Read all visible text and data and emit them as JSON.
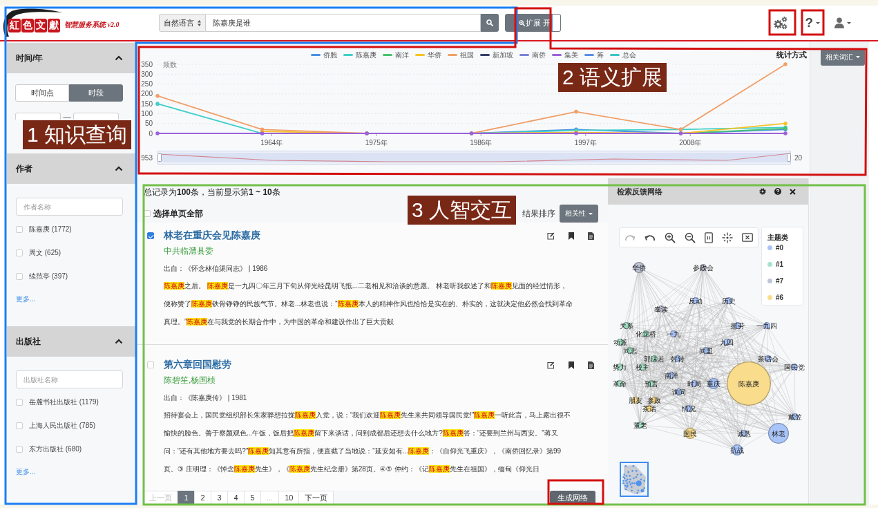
{
  "header": {
    "logo": {
      "tiles": [
        "紅",
        "色",
        "文",
        "獻"
      ],
      "subtitle": "智慧服务系统 v2.0"
    },
    "search": {
      "mode": "自然语言",
      "value": "陈嘉庚是谁"
    },
    "expand_toggle": {
      "label": "扩展",
      "state_label": "开",
      "on": true
    },
    "help_menu": {
      "label": "?"
    }
  },
  "sidebar": {
    "sections": [
      {
        "kind": "time",
        "title": "时间/年",
        "expanded": true,
        "modes": [
          {
            "label": "时间点",
            "selected": false
          },
          {
            "label": "时段",
            "selected": true
          }
        ],
        "separator": "—"
      },
      {
        "kind": "facet",
        "title": "作者",
        "expanded": true,
        "placeholder": "作者名称",
        "items": [
          {
            "label": "陈嘉庚 (1772)",
            "checked": false
          },
          {
            "label": "周文 (625)",
            "checked": false
          },
          {
            "label": "续范亭 (397)",
            "checked": false
          }
        ],
        "more": "更多..."
      },
      {
        "kind": "facet",
        "title": "出版社",
        "expanded": true,
        "placeholder": "出版社名称",
        "items": [
          {
            "label": "岳麓书社出版社 (1179)",
            "checked": false
          },
          {
            "label": "上海人民出版社 (785)",
            "checked": false
          },
          {
            "label": "东方出版社 (680)",
            "checked": false
          }
        ],
        "more": "更多..."
      }
    ]
  },
  "chart_panel": {
    "stat_label": "统计方式",
    "stat_button": "相关词汇",
    "chart_data": {
      "type": "line",
      "ylabel": "频数",
      "grid": true,
      "x": [
        1952,
        1963,
        1974,
        1985,
        1996,
        2007,
        2018
      ],
      "xlim": [
        1952,
        2018
      ],
      "ylim": [
        0,
        350
      ],
      "xticks": [
        {
          "value": 1964,
          "label": "1964年"
        },
        {
          "value": 1975,
          "label": "1975年"
        },
        {
          "value": 1986,
          "label": "1986年"
        },
        {
          "value": 1997,
          "label": "1997年"
        },
        {
          "value": 2008,
          "label": "2008年"
        }
      ],
      "yticks": [
        0,
        50,
        100,
        150,
        200,
        250,
        300,
        350
      ],
      "series": [
        {
          "name": "侨胞",
          "color": "#4a90e2",
          "values": [
            null,
            null,
            null,
            0,
            20,
            0,
            20
          ]
        },
        {
          "name": "陈嘉庚",
          "color": "#3fd0c9",
          "values": [
            150,
            0,
            0,
            0,
            15,
            20,
            30
          ]
        },
        {
          "name": "南洋",
          "color": "#47c36f",
          "values": [
            null,
            null,
            null,
            null,
            null,
            0,
            25
          ]
        },
        {
          "name": "华侨",
          "color": "#f7c325",
          "values": [
            null,
            10,
            0,
            0,
            5,
            0,
            50
          ]
        },
        {
          "name": "祖国",
          "color": "#f0a068",
          "values": [
            190,
            20,
            0,
            0,
            110,
            20,
            350
          ]
        },
        {
          "name": "新加坡",
          "color": "#34406b",
          "values": [
            null,
            null,
            null,
            null,
            null,
            null,
            null
          ]
        },
        {
          "name": "南侨",
          "color": "#7b82d6",
          "values": [
            null,
            null,
            null,
            null,
            null,
            null,
            null
          ]
        },
        {
          "name": "集美",
          "color": "#9a62db",
          "values": [
            0,
            0,
            0,
            0,
            0,
            0,
            0
          ]
        },
        {
          "name": "筹",
          "color": "#5b8ee6",
          "values": [
            null,
            null,
            null,
            null,
            null,
            null,
            null
          ]
        },
        {
          "name": "总会",
          "color": "#3cc5c5",
          "values": [
            null,
            null,
            null,
            null,
            null,
            null,
            null
          ]
        }
      ]
    },
    "zoom_slider": {
      "start_label": "953",
      "end_label": "20",
      "level": 1
    }
  },
  "results": {
    "summary": "总记录为**100**条，当前显示第**1 ~ 10**条",
    "select_all": {
      "label": "选择单页全部",
      "checked": false
    },
    "sort_label": "结果排序",
    "sort_button": "相关性",
    "items": [
      {
        "checked": true,
        "title": "林老在重庆会见陈嘉庚",
        "author": "中共临澧县委",
        "source": "出自：《怀念林伯渠同志》 | 1986",
        "snippet": [
          {
            "text": "陈嘉庚",
            "highlight": true
          },
          {
            "text": "之后。 ",
            "highlight": false
          },
          {
            "text": "陈嘉庚",
            "highlight": true
          },
          {
            "text": "是一九四〇年三月下旬从仰光经昆明飞抵...二老相见和洽谈的意愿。 林老听我叙述了和",
            "highlight": false
          },
          {
            "text": "陈嘉庚",
            "highlight": true
          },
          {
            "text": "见面的经过情形，便称赞了",
            "highlight": false
          },
          {
            "text": "陈嘉庚",
            "highlight": true
          },
          {
            "text": "铁骨铮铮的民族气节。林老...林老也说：“",
            "highlight": false
          },
          {
            "text": "陈嘉庚",
            "highlight": true
          },
          {
            "text": "本人的精神作风也恰恰是实在的、朴实的，这就决定他必然会找到革命真理。”",
            "highlight": false
          },
          {
            "text": "陈嘉庚",
            "highlight": true
          },
          {
            "text": "在与我党的长期合作中，为中国的革命和建设作出了巨大贡献",
            "highlight": false
          }
        ]
      },
      {
        "checked": false,
        "title": "第六章回国慰劳",
        "author": "陈碧笙,杨国桢",
        "source": "出自：《陈嘉庚传》 | 1981",
        "snippet": [
          {
            "text": "招待宴会上，国民党组织部长朱家骅想拉拢",
            "highlight": false
          },
          {
            "text": "陈嘉庚",
            "highlight": true
          },
          {
            "text": "入党，说：“我们欢迎",
            "highlight": false
          },
          {
            "text": "陈嘉庚",
            "highlight": true
          },
          {
            "text": "先生来共同领导国民党!”",
            "highlight": false
          },
          {
            "text": "陈嘉庚",
            "highlight": true
          },
          {
            "text": "一听此言，马上露出很不愉快的脸色。善于察颜观色...午饭，饭后把",
            "highlight": false
          },
          {
            "text": "陈嘉庚",
            "highlight": true
          },
          {
            "text": "留下来谈话，问到成都后还想去什么地方?",
            "highlight": false
          },
          {
            "text": "陈嘉庚",
            "highlight": true
          },
          {
            "text": "答：“还要到兰州与西安。”蒋又问：“还有其他地方要去吗?”",
            "highlight": false
          },
          {
            "text": "陈嘉庚",
            "highlight": true
          },
          {
            "text": "知其意有所指，便直截了当地说：“延安如有...",
            "highlight": false
          },
          {
            "text": "陈嘉庚",
            "highlight": true
          },
          {
            "text": "：《自仰光飞重庆》，《南侨回忆录》第99页。③ 庄明理：《悼念",
            "highlight": false
          },
          {
            "text": "陈嘉庚",
            "highlight": true
          },
          {
            "text": "先生》，《",
            "highlight": false
          },
          {
            "text": "陈嘉庚",
            "highlight": true
          },
          {
            "text": "先生纪念册》第28页。④⑤ 仲约：《记",
            "highlight": false
          },
          {
            "text": "陈嘉庚",
            "highlight": true
          },
          {
            "text": "先生在祖国》，缅甸《仰光日",
            "highlight": false
          }
        ]
      }
    ],
    "pagination": [
      {
        "label": "上一页",
        "selected": false,
        "disabled": true
      },
      {
        "label": "1",
        "selected": true,
        "disabled": false
      },
      {
        "label": "2",
        "selected": false,
        "disabled": false
      },
      {
        "label": "3",
        "selected": false,
        "disabled": false
      },
      {
        "label": "4",
        "selected": false,
        "disabled": false
      },
      {
        "label": "5",
        "selected": false,
        "disabled": false
      },
      {
        "label": "...",
        "selected": false,
        "disabled": true
      },
      {
        "label": "10",
        "selected": false,
        "disabled": false
      },
      {
        "label": "下一页",
        "selected": false,
        "disabled": false
      }
    ],
    "generate_button": "生成网络"
  },
  "network_panel": {
    "title": "检索反馈网络",
    "legend_title": "主题类",
    "legend": [
      {
        "label": "#0",
        "color": "#a9c4f8"
      },
      {
        "label": "#1",
        "color": "#a7e4c9"
      },
      {
        "label": "#7",
        "color": "#bfc4d6"
      },
      {
        "label": "#6",
        "color": "#f9dc8c"
      }
    ],
    "nodes": [
      {
        "label": "华侨",
        "color": "#bfc4d6",
        "kind": "medium"
      },
      {
        "label": "参政会",
        "color": "#bfc4d6",
        "kind": "small"
      },
      {
        "label": "反动",
        "color": "#a9c4f8",
        "kind": "small"
      },
      {
        "label": "历史",
        "color": "#a9c4f8",
        "kind": "small"
      },
      {
        "label": "奉读",
        "color": "#bfc4d6",
        "kind": "small"
      },
      {
        "label": "关系",
        "color": "#a7e4c9",
        "kind": "small"
      },
      {
        "label": "慰劳",
        "color": "#a9c4f8",
        "kind": "small"
      },
      {
        "label": "一九四",
        "color": "#a9c4f8",
        "kind": "small"
      },
      {
        "label": "化龙桥",
        "color": "#a7e4c9",
        "kind": "small"
      },
      {
        "label": "一九",
        "color": "#a9c4f8",
        "kind": "small"
      },
      {
        "label": "动派",
        "color": "#a7e4c9",
        "kind": "small"
      },
      {
        "label": "九四",
        "color": "#a9c4f8",
        "kind": "small"
      },
      {
        "label": "同志",
        "color": "#a7e4c9",
        "kind": "small"
      },
      {
        "label": "同盟",
        "color": "#a9c4f8",
        "kind": "small"
      },
      {
        "label": "郭沫若",
        "color": "#a7e4c9",
        "kind": "small"
      },
      {
        "label": "好转",
        "color": "#a9c4f8",
        "kind": "small"
      },
      {
        "label": "茶话会",
        "color": "#a9c4f8",
        "kind": "small"
      },
      {
        "label": "势力",
        "color": "#a7e4c9",
        "kind": "small"
      },
      {
        "label": "校主",
        "color": "#a7e4c9",
        "kind": "small"
      },
      {
        "label": "国民党",
        "color": "#a9c4f8",
        "kind": "small"
      },
      {
        "label": "南洋",
        "color": "#a9c4f8",
        "kind": "small"
      },
      {
        "label": "革命",
        "color": "#a7e4c9",
        "kind": "small"
      },
      {
        "label": "预言",
        "color": "#a7e4c9",
        "kind": "small"
      },
      {
        "label": "时局",
        "color": "#a9c4f8",
        "kind": "small"
      },
      {
        "label": "重庆",
        "color": "#a9c4f8",
        "kind": "medium"
      },
      {
        "label": "陈嘉庚",
        "color": "#f9dc8c",
        "kind": "center"
      },
      {
        "label": "询问",
        "color": "#a9c4f8",
        "kind": "small"
      },
      {
        "label": "朋友",
        "color": "#f9dc8c",
        "kind": "small"
      },
      {
        "label": "参政",
        "color": "#f9dc8c",
        "kind": "small"
      },
      {
        "label": "茶话",
        "color": "#f9dc8c",
        "kind": "small"
      },
      {
        "label": "情况",
        "color": "#a9c4f8",
        "kind": "small"
      },
      {
        "label": "戴笠",
        "color": "#a9c4f8",
        "kind": "small"
      },
      {
        "label": "董老",
        "color": "#a7e4c9",
        "kind": "small"
      },
      {
        "label": "国民",
        "color": "#f9dc8c",
        "kind": "medium"
      },
      {
        "label": "诚恳",
        "color": "#a9c4f8",
        "kind": "small"
      },
      {
        "label": "林老",
        "color": "#a9c4f8",
        "kind": "large"
      },
      {
        "label": "抗战",
        "color": "#a9c4f8",
        "kind": "medium"
      }
    ]
  },
  "annotations": {
    "frames": [
      {
        "color": "#1a7ef5"
      },
      {
        "color": "#d30f0f"
      },
      {
        "color": "#72c04a"
      },
      {
        "color": "#d30f0f"
      },
      {
        "color": "#d30f0f"
      },
      {
        "color": "#d30f0f"
      }
    ],
    "labels": [
      "1 知识查询",
      "2 语义扩展",
      "3 人智交互"
    ]
  }
}
